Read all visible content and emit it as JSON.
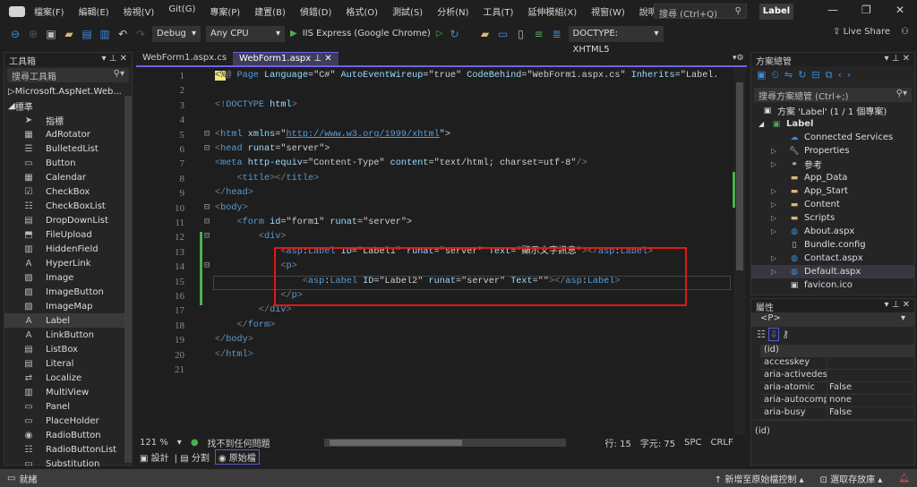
{
  "menu": [
    "檔案(F)",
    "編輯(E)",
    "檢視(V)",
    "Git(G)",
    "專案(P)",
    "建置(B)",
    "偵錯(D)",
    "格式(O)",
    "測試(S)",
    "分析(N)",
    "工具(T)",
    "延伸模組(X)",
    "視窗(W)",
    "說明(H)"
  ],
  "search_placeholder": "搜尋 (Ctrl+Q)",
  "window_title": "Label",
  "toolbar": {
    "config": "Debug",
    "platform": "Any CPU",
    "run": "IIS Express (Google Chrome)",
    "doctype": "DOCTYPE: XHTML5",
    "live_share": "Live Share"
  },
  "toolbox": {
    "title": "工具箱",
    "search": "搜尋工具箱",
    "group1": "Microsoft.AspNet.Web...",
    "group2": "標準",
    "items": [
      "指標",
      "AdRotator",
      "BulletedList",
      "Button",
      "Calendar",
      "CheckBox",
      "CheckBoxList",
      "DropDownList",
      "FileUpload",
      "HiddenField",
      "HyperLink",
      "Image",
      "ImageButton",
      "ImageMap",
      "Label",
      "LinkButton",
      "ListBox",
      "Literal",
      "Localize",
      "MultiView",
      "Panel",
      "PlaceHolder",
      "RadioButton",
      "RadioButtonList",
      "Substitution"
    ],
    "selected": "Label"
  },
  "tabs": [
    {
      "label": "WebForm1.aspx.cs",
      "active": false
    },
    {
      "label": "WebForm1.aspx",
      "active": true
    }
  ],
  "code": [
    [
      [
        "<%",
        "hl"
      ],
      [
        "@ ",
        "d"
      ],
      [
        "Page ",
        "t"
      ],
      [
        "Language",
        "a"
      ],
      [
        "=\"C#\" ",
        "v"
      ],
      [
        "AutoEventWireup",
        "a"
      ],
      [
        "=\"true\" ",
        "v"
      ],
      [
        "CodeBehind",
        "a"
      ],
      [
        "=\"WebForm1.aspx.cs\" ",
        "v"
      ],
      [
        "Inherits",
        "a"
      ],
      [
        "=\"Label.",
        "v"
      ]
    ],
    [],
    [
      [
        "<!",
        "d"
      ],
      [
        "DOCTYPE ",
        "t"
      ],
      [
        "html",
        "a"
      ],
      [
        ">",
        "d"
      ]
    ],
    [],
    [
      [
        "<",
        "d"
      ],
      [
        "html ",
        "t"
      ],
      [
        "xmlns",
        "a"
      ],
      [
        "=\"",
        "v"
      ],
      [
        "http://www.w3.org/1999/xhtml",
        "u"
      ],
      [
        "\">",
        "v"
      ]
    ],
    [
      [
        "<",
        "d"
      ],
      [
        "head ",
        "t"
      ],
      [
        "runat",
        "a"
      ],
      [
        "=\"server\">",
        "v"
      ]
    ],
    [
      [
        "<",
        "d"
      ],
      [
        "meta ",
        "t"
      ],
      [
        "http-equiv",
        "a"
      ],
      [
        "=\"Content-Type\" ",
        "v"
      ],
      [
        "content",
        "a"
      ],
      [
        "=\"text/html; charset=utf-8\"",
        "v"
      ],
      [
        "/>",
        "d"
      ]
    ],
    [
      [
        "    <",
        "d"
      ],
      [
        "title",
        "t"
      ],
      [
        "></",
        "d"
      ],
      [
        "title",
        "t"
      ],
      [
        ">",
        "d"
      ]
    ],
    [
      [
        "</",
        "d"
      ],
      [
        "head",
        "t"
      ],
      [
        ">",
        "d"
      ]
    ],
    [
      [
        "<",
        "d"
      ],
      [
        "body",
        "t"
      ],
      [
        ">",
        "d"
      ]
    ],
    [
      [
        "    <",
        "d"
      ],
      [
        "form ",
        "t"
      ],
      [
        "id",
        "a"
      ],
      [
        "=\"form1\" ",
        "v"
      ],
      [
        "runat",
        "a"
      ],
      [
        "=\"server\">",
        "v"
      ]
    ],
    [
      [
        "        <",
        "d"
      ],
      [
        "div",
        "t"
      ],
      [
        ">",
        "d"
      ]
    ],
    [
      [
        "            <",
        "d"
      ],
      [
        "asp",
        "t"
      ],
      [
        ":",
        "v"
      ],
      [
        "Label ",
        "t"
      ],
      [
        "ID",
        "a"
      ],
      [
        "=\"Label1\" ",
        "v"
      ],
      [
        "runat",
        "a"
      ],
      [
        "=\"server\" ",
        "v"
      ],
      [
        "Text",
        "a"
      ],
      [
        "=\"顯示文字訊息\"",
        "v"
      ],
      [
        "></",
        "d"
      ],
      [
        "asp",
        "t"
      ],
      [
        ":",
        "v"
      ],
      [
        "Label",
        "t"
      ],
      [
        ">",
        "d"
      ]
    ],
    [
      [
        "            <",
        "d"
      ],
      [
        "p",
        "t"
      ],
      [
        ">",
        "d"
      ]
    ],
    [
      [
        "                <",
        "d"
      ],
      [
        "asp",
        "t"
      ],
      [
        ":",
        "v"
      ],
      [
        "Label ",
        "t"
      ],
      [
        "ID",
        "a"
      ],
      [
        "=\"Label2\" ",
        "v"
      ],
      [
        "runat",
        "a"
      ],
      [
        "=\"server\" ",
        "v"
      ],
      [
        "Text",
        "a"
      ],
      [
        "=\"\"",
        "v"
      ],
      [
        "></",
        "d"
      ],
      [
        "asp",
        "t"
      ],
      [
        ":",
        "v"
      ],
      [
        "Label",
        "t"
      ],
      [
        ">",
        "d"
      ]
    ],
    [
      [
        "            </",
        "d"
      ],
      [
        "p",
        "t"
      ],
      [
        ">",
        "d"
      ]
    ],
    [
      [
        "        </",
        "d"
      ],
      [
        "div",
        "t"
      ],
      [
        ">",
        "d"
      ]
    ],
    [
      [
        "    </",
        "d"
      ],
      [
        "form",
        "t"
      ],
      [
        ">",
        "d"
      ]
    ],
    [
      [
        "</",
        "d"
      ],
      [
        "body",
        "t"
      ],
      [
        ">",
        "d"
      ]
    ],
    [
      [
        "</",
        "d"
      ],
      [
        "html",
        "t"
      ],
      [
        ">",
        "d"
      ]
    ],
    []
  ],
  "editor_status": {
    "zoom": "121 %",
    "issues": "找不到任何問題",
    "line": "行: 15",
    "char": "字元: 75",
    "spc": "SPC",
    "crlf": "CRLF"
  },
  "view_tabs": [
    "設計",
    "分割",
    "原始檔"
  ],
  "solution": {
    "title": "方案總管",
    "search": "搜尋方案總管 (Ctrl+;)",
    "root": "方案 'Label' (1 / 1 個專案)",
    "project": "Label",
    "items": [
      {
        "label": "Connected Services",
        "icon": "cloud-icon"
      },
      {
        "label": "Properties",
        "icon": "wrench-icon"
      },
      {
        "label": "參考",
        "icon": "reference-icon"
      },
      {
        "label": "App_Data",
        "icon": "folder-icon"
      },
      {
        "label": "App_Start",
        "icon": "folder-icon"
      },
      {
        "label": "Content",
        "icon": "folder-icon"
      },
      {
        "label": "Scripts",
        "icon": "folder-icon"
      },
      {
        "label": "About.aspx",
        "icon": "web-file-icon"
      },
      {
        "label": "Bundle.config",
        "icon": "config-file-icon"
      },
      {
        "label": "Contact.aspx",
        "icon": "web-file-icon"
      },
      {
        "label": "Default.aspx",
        "icon": "web-file-icon"
      },
      {
        "label": "favicon.ico",
        "icon": "image-file-icon"
      }
    ]
  },
  "properties": {
    "title": "屬性",
    "object": "<P>",
    "rows": [
      [
        "(id)",
        ""
      ],
      [
        "accesskey",
        ""
      ],
      [
        "aria-activedesce",
        ""
      ],
      [
        "aria-atomic",
        "False"
      ],
      [
        "aria-autocompl",
        "none"
      ],
      [
        "aria-busy",
        "False"
      ]
    ],
    "description": "(id)"
  },
  "status": {
    "ready": "就緒",
    "source_control": "新增至原始檔控制",
    "repo": "選取存放庫"
  },
  "colors": {
    "accent": "#7160e8",
    "highlight_box": "#e01818",
    "modified_gutter": "#4caf50"
  }
}
